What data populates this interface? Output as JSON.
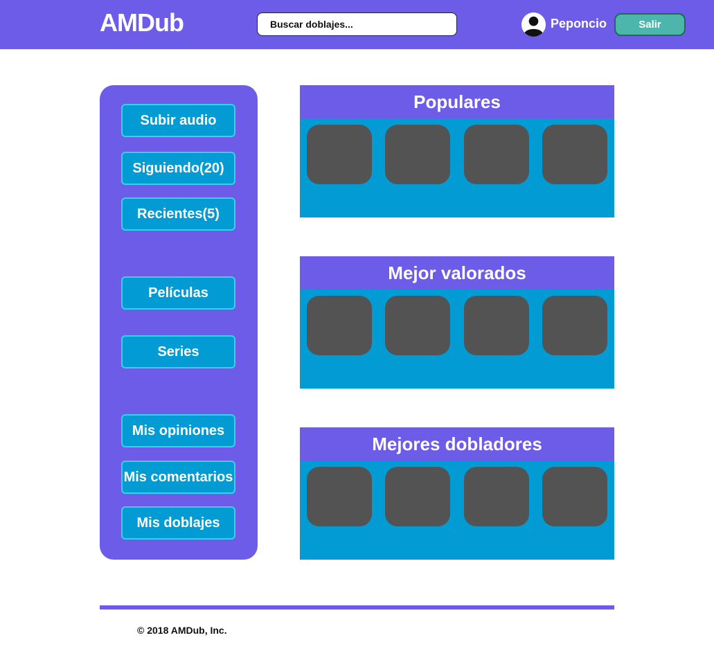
{
  "header": {
    "logo": "AMDub",
    "search_placeholder": "Buscar doblajes...",
    "avatar_icon": "user-avatar-icon",
    "username": "Peponcio",
    "logout_label": "Salir"
  },
  "sidebar": {
    "items": [
      {
        "label": "Subir audio"
      },
      {
        "label": "Siguiendo(20)"
      },
      {
        "label": "Recientes(5)"
      },
      {
        "label": "Películas"
      },
      {
        "label": "Series"
      },
      {
        "label": "Mis opiniones"
      },
      {
        "label": "Mis comentarios"
      },
      {
        "label": "Mis doblajes"
      }
    ]
  },
  "sections": [
    {
      "title": "Populares"
    },
    {
      "title": "Mejor valorados"
    },
    {
      "title": "Mejores dobladores"
    }
  ],
  "footer": {
    "copyright": "© 2018 AMDub, Inc."
  },
  "colors": {
    "primary": "#6c5ce7",
    "secondary": "#039bd3",
    "button_border": "#39d0f0",
    "logout": "#4db6ac",
    "thumb": "#535353"
  }
}
